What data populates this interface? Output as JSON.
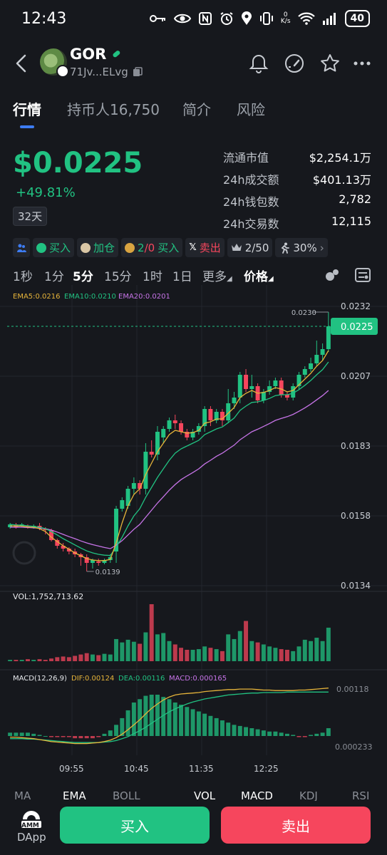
{
  "status_bar": {
    "time": "12:43",
    "net_speed_top": "0",
    "net_speed_unit": "K/s",
    "battery": "40"
  },
  "header": {
    "symbol": "GOR",
    "address": "71Jv...ELvg"
  },
  "tabs": [
    {
      "label": "行情",
      "active": true
    },
    {
      "label": "持币人16,750",
      "active": false
    },
    {
      "label": "简介",
      "active": false
    },
    {
      "label": "风险",
      "active": false
    }
  ],
  "price": {
    "value": "$0.0225",
    "change": "+49.81%",
    "period": "32天"
  },
  "stats": [
    {
      "label": "流通市值",
      "value": "$2,254.1万"
    },
    {
      "label": "24h成交额",
      "value": "$401.13万"
    },
    {
      "label": "24h钱包数",
      "value": "2,782"
    },
    {
      "label": "24h交易数",
      "value": "12,115"
    }
  ],
  "tags": {
    "buy1": "买入",
    "add": "加仓",
    "ratio_a": "2",
    "ratio_b": "/0",
    "buy2": "买入",
    "sell": "卖出",
    "count": "2/50",
    "percent": "30%"
  },
  "intervals": [
    {
      "label": "1秒",
      "active": false
    },
    {
      "label": "1分",
      "active": false
    },
    {
      "label": "5分",
      "active": true
    },
    {
      "label": "15分",
      "active": false
    },
    {
      "label": "1时",
      "active": false
    },
    {
      "label": "1日",
      "active": false
    },
    {
      "label": "更多",
      "active": false
    },
    {
      "label": "价格",
      "active": true
    }
  ],
  "chart_data": {
    "type": "candlestick",
    "ema_legend": [
      {
        "name": "EMA5",
        "value": "0.0216",
        "color": "#e6b43a"
      },
      {
        "name": "EMA10",
        "value": "0.0210",
        "color": "#21c282"
      },
      {
        "name": "EMA20",
        "value": "0.0201",
        "color": "#c774e8"
      }
    ],
    "y_ticks": [
      "0.0232",
      "0.0207",
      "0.0183",
      "0.0158",
      "0.0134"
    ],
    "y_range": [
      0.0134,
      0.0232
    ],
    "current_price": "0.0225",
    "high_label": "0.0230",
    "low_label": "0.0139",
    "x_ticks": [
      "09:55",
      "10:45",
      "11:35",
      "12:25"
    ],
    "candles": [
      {
        "o": 0.01545,
        "c": 0.01555,
        "h": 0.0156,
        "l": 0.0154
      },
      {
        "o": 0.01555,
        "c": 0.01545,
        "h": 0.0156,
        "l": 0.0154
      },
      {
        "o": 0.0155,
        "c": 0.01555,
        "h": 0.0156,
        "l": 0.01545
      },
      {
        "o": 0.0155,
        "c": 0.01545,
        "h": 0.01555,
        "l": 0.0154
      },
      {
        "o": 0.01545,
        "c": 0.0155,
        "h": 0.01555,
        "l": 0.0154
      },
      {
        "o": 0.0155,
        "c": 0.0154,
        "h": 0.0156,
        "l": 0.01535
      },
      {
        "o": 0.0154,
        "c": 0.01535,
        "h": 0.01545,
        "l": 0.0152
      },
      {
        "o": 0.01535,
        "c": 0.015,
        "h": 0.0154,
        "l": 0.01495
      },
      {
        "o": 0.015,
        "c": 0.0148,
        "h": 0.01505,
        "l": 0.0147
      },
      {
        "o": 0.0148,
        "c": 0.0147,
        "h": 0.0149,
        "l": 0.0146
      },
      {
        "o": 0.0147,
        "c": 0.0146,
        "h": 0.01475,
        "l": 0.0145
      },
      {
        "o": 0.0146,
        "c": 0.0145,
        "h": 0.0147,
        "l": 0.0144
      },
      {
        "o": 0.0145,
        "c": 0.0144,
        "h": 0.01455,
        "l": 0.0141
      },
      {
        "o": 0.0144,
        "c": 0.0142,
        "h": 0.0145,
        "l": 0.0139
      },
      {
        "o": 0.0142,
        "c": 0.0143,
        "h": 0.01435,
        "l": 0.014
      },
      {
        "o": 0.01425,
        "c": 0.0142,
        "h": 0.01435,
        "l": 0.0141
      },
      {
        "o": 0.0142,
        "c": 0.0143,
        "h": 0.01435,
        "l": 0.01415
      },
      {
        "o": 0.0143,
        "c": 0.0144,
        "h": 0.0145,
        "l": 0.0142
      },
      {
        "o": 0.0146,
        "c": 0.0161,
        "h": 0.0162,
        "l": 0.0142
      },
      {
        "o": 0.0161,
        "c": 0.0164,
        "h": 0.0165,
        "l": 0.016
      },
      {
        "o": 0.0162,
        "c": 0.0168,
        "h": 0.0169,
        "l": 0.0161
      },
      {
        "o": 0.0168,
        "c": 0.017,
        "h": 0.0172,
        "l": 0.0166
      },
      {
        "o": 0.017,
        "c": 0.0168,
        "h": 0.0171,
        "l": 0.0166
      },
      {
        "o": 0.0168,
        "c": 0.0181,
        "h": 0.0184,
        "l": 0.0166
      },
      {
        "o": 0.0181,
        "c": 0.018,
        "h": 0.0185,
        "l": 0.0179
      },
      {
        "o": 0.018,
        "c": 0.0188,
        "h": 0.019,
        "l": 0.0178
      },
      {
        "o": 0.0186,
        "c": 0.0189,
        "h": 0.019,
        "l": 0.0184
      },
      {
        "o": 0.0189,
        "c": 0.0192,
        "h": 0.0193,
        "l": 0.0188
      },
      {
        "o": 0.0192,
        "c": 0.0191,
        "h": 0.0194,
        "l": 0.0189
      },
      {
        "o": 0.0191,
        "c": 0.0188,
        "h": 0.0192,
        "l": 0.0187
      },
      {
        "o": 0.0188,
        "c": 0.0186,
        "h": 0.0189,
        "l": 0.0185
      },
      {
        "o": 0.0186,
        "c": 0.0188,
        "h": 0.0189,
        "l": 0.0185
      },
      {
        "o": 0.0188,
        "c": 0.019,
        "h": 0.0191,
        "l": 0.0187
      },
      {
        "o": 0.019,
        "c": 0.0196,
        "h": 0.0197,
        "l": 0.0188
      },
      {
        "o": 0.0196,
        "c": 0.0192,
        "h": 0.0197,
        "l": 0.019
      },
      {
        "o": 0.0192,
        "c": 0.0195,
        "h": 0.0196,
        "l": 0.0191
      },
      {
        "o": 0.0195,
        "c": 0.0192,
        "h": 0.0196,
        "l": 0.019
      },
      {
        "o": 0.0192,
        "c": 0.0198,
        "h": 0.0203,
        "l": 0.0191
      },
      {
        "o": 0.0198,
        "c": 0.02,
        "h": 0.0202,
        "l": 0.0196
      },
      {
        "o": 0.02,
        "c": 0.0208,
        "h": 0.0209,
        "l": 0.0198
      },
      {
        "o": 0.0208,
        "c": 0.0203,
        "h": 0.021,
        "l": 0.0202
      },
      {
        "o": 0.0203,
        "c": 0.0204,
        "h": 0.0208,
        "l": 0.02
      },
      {
        "o": 0.0204,
        "c": 0.0199,
        "h": 0.0205,
        "l": 0.0198
      },
      {
        "o": 0.0199,
        "c": 0.0202,
        "h": 0.0203,
        "l": 0.0198
      },
      {
        "o": 0.0202,
        "c": 0.0204,
        "h": 0.0206,
        "l": 0.0201
      },
      {
        "o": 0.0204,
        "c": 0.0206,
        "h": 0.0207,
        "l": 0.0203
      },
      {
        "o": 0.0206,
        "c": 0.0201,
        "h": 0.0207,
        "l": 0.02
      },
      {
        "o": 0.0201,
        "c": 0.02,
        "h": 0.0202,
        "l": 0.0199
      },
      {
        "o": 0.02,
        "c": 0.0204,
        "h": 0.0205,
        "l": 0.0199
      },
      {
        "o": 0.0204,
        "c": 0.0208,
        "h": 0.0209,
        "l": 0.0203
      },
      {
        "o": 0.0208,
        "c": 0.021,
        "h": 0.0211,
        "l": 0.0207
      },
      {
        "o": 0.021,
        "c": 0.0212,
        "h": 0.0214,
        "l": 0.0209
      },
      {
        "o": 0.0212,
        "c": 0.0215,
        "h": 0.022,
        "l": 0.0211
      },
      {
        "o": 0.0215,
        "c": 0.0217,
        "h": 0.0219,
        "l": 0.0213
      },
      {
        "o": 0.0217,
        "c": 0.0225,
        "h": 0.023,
        "l": 0.0216
      }
    ],
    "ema5": [
      0.0155,
      0.01549,
      0.01549,
      0.01546,
      0.01545,
      0.0154,
      0.0153,
      0.0151,
      0.01495,
      0.0148,
      0.01468,
      0.01455,
      0.01445,
      0.01435,
      0.0143,
      0.01428,
      0.01428,
      0.01432,
      0.0149,
      0.0156,
      0.0162,
      0.0166,
      0.0168,
      0.0173,
      0.0177,
      0.0181,
      0.0184,
      0.0187,
      0.01885,
      0.0188,
      0.01875,
      0.01877,
      0.01885,
      0.0191,
      0.01915,
      0.01925,
      0.01925,
      0.01945,
      0.01965,
      0.02,
      0.02015,
      0.02025,
      0.02015,
      0.02018,
      0.02025,
      0.02035,
      0.0203,
      0.0202,
      0.02025,
      0.02045,
      0.02065,
      0.02085,
      0.0211,
      0.0213,
      0.02165
    ],
    "ema10": [
      0.01555,
      0.01553,
      0.01552,
      0.0155,
      0.01548,
      0.01545,
      0.0154,
      0.0153,
      0.01518,
      0.01505,
      0.01494,
      0.01483,
      0.01472,
      0.01462,
      0.01455,
      0.0145,
      0.01447,
      0.01446,
      0.01475,
      0.0151,
      0.0155,
      0.01585,
      0.0161,
      0.0165,
      0.01685,
      0.0172,
      0.0175,
      0.0178,
      0.01805,
      0.0182,
      0.0183,
      0.0184,
      0.0185,
      0.0187,
      0.0188,
      0.0189,
      0.01897,
      0.01912,
      0.01928,
      0.01955,
      0.0197,
      0.01983,
      0.01985,
      0.0199,
      0.01997,
      0.02007,
      0.0201,
      0.0201,
      0.02015,
      0.02028,
      0.02043,
      0.0206,
      0.0208,
      0.02098,
      0.02125
    ],
    "ema20": [
      0.01545,
      0.01545,
      0.01545,
      0.01544,
      0.01543,
      0.01542,
      0.0154,
      0.01535,
      0.01528,
      0.0152,
      0.01512,
      0.01505,
      0.01497,
      0.0149,
      0.01484,
      0.01479,
      0.01474,
      0.0147,
      0.01482,
      0.01498,
      0.01518,
      0.01538,
      0.01555,
      0.0158,
      0.01605,
      0.0163,
      0.01652,
      0.01675,
      0.01695,
      0.01712,
      0.01725,
      0.01737,
      0.0175,
      0.01767,
      0.0178,
      0.01794,
      0.01805,
      0.01819,
      0.01833,
      0.01852,
      0.01866,
      0.0188,
      0.01889,
      0.01899,
      0.01909,
      0.0192,
      0.01927,
      0.01933,
      0.01941,
      0.01952,
      0.01964,
      0.01977,
      0.01992,
      0.02007,
      0.02025
    ],
    "volume_label": "VOL:1,752,713.62",
    "volume": [
      2,
      2,
      2,
      3,
      2,
      3,
      2,
      4,
      6,
      7,
      6,
      8,
      10,
      12,
      10,
      9,
      11,
      10,
      33,
      28,
      32,
      29,
      26,
      43,
      85,
      40,
      42,
      30,
      25,
      20,
      17,
      17,
      18,
      22,
      20,
      18,
      15,
      40,
      33,
      45,
      60,
      30,
      28,
      25,
      22,
      20,
      18,
      17,
      15,
      22,
      32,
      30,
      35,
      30,
      50
    ],
    "macd_label": "MACD(12,26,9)",
    "dif_label": "DIF:0.00124",
    "dea_label": "DEA:0.00116",
    "macd_value_label": "MACD:0.000165",
    "macd_ticks": [
      "0.00118",
      "0.000233"
    ],
    "macd_range": [
      0.0001,
      0.00125
    ],
    "dif": [
      0.00025,
      0.00025,
      0.00024,
      0.00023,
      0.00022,
      0.0002,
      0.00018,
      0.00016,
      0.00015,
      0.00014,
      0.00013,
      0.00012,
      0.00012,
      0.00012,
      0.00013,
      0.00014,
      0.00016,
      0.00019,
      0.00024,
      0.00031,
      0.0004,
      0.0005,
      0.0006,
      0.00072,
      0.00083,
      0.00092,
      0.001,
      0.00106,
      0.0011,
      0.00112,
      0.00113,
      0.00114,
      0.00115,
      0.00117,
      0.00118,
      0.00119,
      0.0012,
      0.00121,
      0.00121,
      0.00122,
      0.00122,
      0.00122,
      0.00121,
      0.0012,
      0.0012,
      0.00119,
      0.00119,
      0.00119,
      0.00119,
      0.0012,
      0.0012,
      0.00121,
      0.00122,
      0.00123,
      0.00124
    ],
    "dea": [
      0.00022,
      0.00022,
      0.00022,
      0.00021,
      0.00021,
      0.0002,
      0.00019,
      0.00018,
      0.00017,
      0.00016,
      0.00015,
      0.00014,
      0.00014,
      0.00014,
      0.00014,
      0.00014,
      0.00015,
      0.00016,
      0.00018,
      0.00022,
      0.00026,
      0.00032,
      0.00038,
      0.00045,
      0.00053,
      0.00061,
      0.00069,
      0.00076,
      0.00082,
      0.00087,
      0.00092,
      0.00096,
      0.00099,
      0.00102,
      0.00104,
      0.00106,
      0.00108,
      0.0011,
      0.00111,
      0.00112,
      0.00113,
      0.00114,
      0.00114,
      0.00115,
      0.00115,
      0.00115,
      0.00115,
      0.00116,
      0.00116,
      0.00116,
      0.00116,
      0.00116,
      0.00116,
      0.00116,
      0.00116
    ],
    "hist": [
      3e-05,
      3e-05,
      3e-05,
      3e-05,
      2e-05,
      1e-05,
      0.0,
      -1e-05,
      -1e-05,
      -1e-05,
      -1e-05,
      -2e-05,
      -2e-05,
      -2e-05,
      -2e-05,
      -1e-05,
      2e-05,
      5e-05,
      0.0001,
      0.00016,
      0.00023,
      0.0003,
      0.00033,
      0.00036,
      0.00037,
      0.00037,
      0.00035,
      0.00033,
      0.0003,
      0.00028,
      0.00026,
      0.00024,
      0.00022,
      0.0002,
      0.00018,
      0.00016,
      0.00014,
      0.00012,
      0.0001,
      9e-05,
      8e-05,
      7e-05,
      6e-05,
      5e-05,
      4e-05,
      4e-05,
      3e-05,
      2e-05,
      1e-05,
      -1e-05,
      -1e-05,
      1e-05,
      2e-05,
      3e-05,
      7e-05
    ]
  },
  "bottom_tabs": [
    {
      "label": "MA",
      "active": false
    },
    {
      "label": "EMA",
      "active": true
    },
    {
      "label": "BOLL",
      "active": false
    },
    {
      "label": "VOL",
      "active": true
    },
    {
      "label": "MACD",
      "active": true
    },
    {
      "label": "KDJ",
      "active": false
    },
    {
      "label": "RSI",
      "active": false
    }
  ],
  "footer": {
    "dapp_label": "DApp",
    "amm_text": "AMM",
    "buy_label": "买入",
    "sell_label": "卖出"
  },
  "colors": {
    "up": "#21c282",
    "down": "#f6465d",
    "accent": "#3d7cf2",
    "background": "#16181d"
  }
}
